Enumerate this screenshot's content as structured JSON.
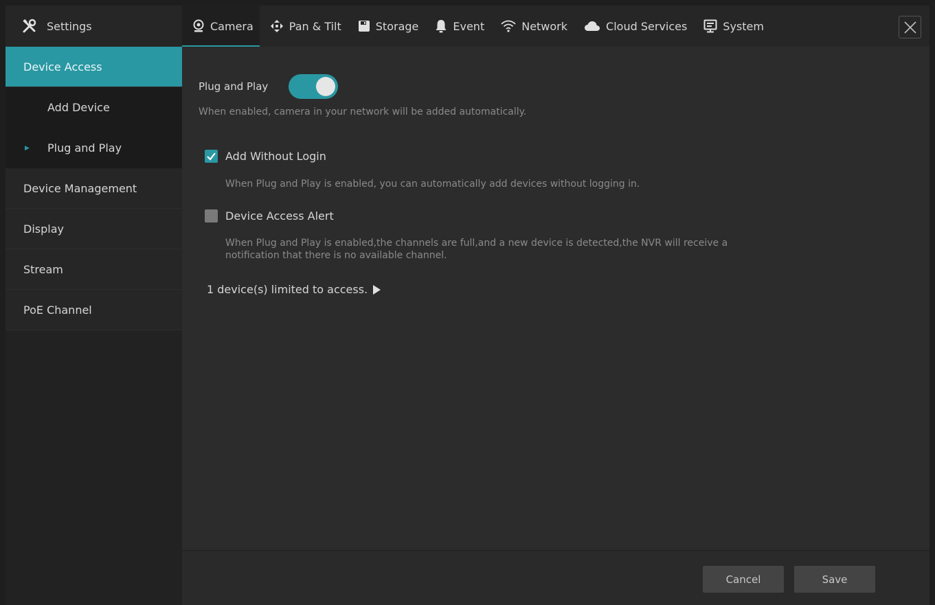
{
  "brand": {
    "title": "Settings",
    "icon": "settings-tools-icon"
  },
  "tabs": [
    {
      "label": "Camera",
      "icon": "camera-icon",
      "active": true
    },
    {
      "label": "Pan & Tilt",
      "icon": "pan-tilt-icon"
    },
    {
      "label": "Storage",
      "icon": "storage-icon"
    },
    {
      "label": "Event",
      "icon": "bell-icon"
    },
    {
      "label": "Network",
      "icon": "wifi-icon"
    },
    {
      "label": "Cloud Services",
      "icon": "cloud-icon"
    },
    {
      "label": "System",
      "icon": "monitor-icon"
    }
  ],
  "sidebar": {
    "items": [
      {
        "label": "Device Access",
        "active": true
      },
      {
        "label": "Add Device",
        "sub": true
      },
      {
        "label": "Plug and Play",
        "sub": true,
        "selected": true
      },
      {
        "label": "Device Management"
      },
      {
        "label": "Display"
      },
      {
        "label": "Stream"
      },
      {
        "label": "PoE Channel"
      }
    ]
  },
  "main": {
    "plug_and_play_label": "Plug and Play",
    "plug_and_play_enabled": true,
    "plug_and_play_help": "When enabled, camera in your network will be added automatically.",
    "add_without_login_label": "Add Without Login",
    "add_without_login_checked": true,
    "add_without_login_help": "When Plug and Play is enabled, you can automatically add devices without logging in.",
    "access_alert_label": "Device Access Alert",
    "access_alert_checked": false,
    "access_alert_help_line1": "When Plug and Play is enabled,the channels are full,and a new device is detected,the NVR will receive a",
    "access_alert_help_line2": "notification that there is no available channel.",
    "limited_text": "1 device(s) limited to access."
  },
  "footer": {
    "cancel_label": "Cancel",
    "save_label": "Save"
  },
  "colors": {
    "accent": "#2a98a3",
    "background": "#2c2c2c",
    "sidebar": "#222222"
  }
}
